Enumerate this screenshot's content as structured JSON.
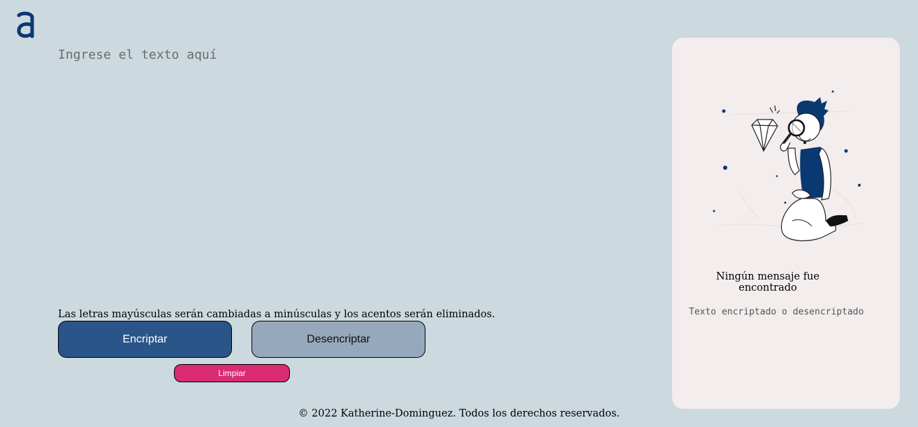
{
  "logo": {
    "icon": "alura-logo-icon",
    "color": "#0a3871"
  },
  "input": {
    "placeholder": "Ingrese el texto aquí",
    "value": ""
  },
  "note": "Las letras mayúsculas serán cambiadas a minúsculas y los acentos serán eliminados.",
  "buttons": {
    "encrypt": "Encriptar",
    "decrypt": "Desencriptar",
    "clear": "Limpiar"
  },
  "output_panel": {
    "illustration": "person-with-magnifying-glass-illustration",
    "title": "Ningún mensaje fue encontrado",
    "subtitle": "Texto encriptado o desencriptado"
  },
  "footer": "© 2022 Katherine-Dominguez. Todos los derechos reservados.",
  "colors": {
    "background": "#ccd9df",
    "primary": "#2a5589",
    "secondary": "#96a8bc",
    "danger": "#da2b72",
    "panel": "#f3eded"
  }
}
